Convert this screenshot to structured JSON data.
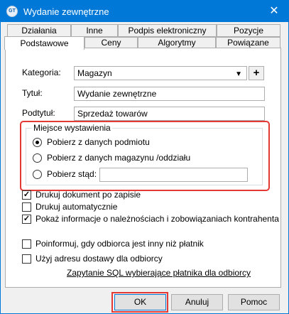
{
  "window": {
    "title": "Wydanie zewnętrzne",
    "icon_text": "GT",
    "close_glyph": "✕"
  },
  "tabs": {
    "row1": [
      "Działania",
      "Inne",
      "Podpis elektroniczny",
      "Pozycje"
    ],
    "row2": [
      "Podstawowe",
      "Ceny",
      "Algorytmy",
      "Powiązane"
    ],
    "active": "Podstawowe"
  },
  "form": {
    "kategoria": {
      "label": "Kategoria:",
      "value": "Magazyn",
      "add_glyph": "+"
    },
    "tytul": {
      "label": "Tytuł:",
      "value": "Wydanie zewnętrzne"
    },
    "podtytul": {
      "label": "Podtytuł:",
      "value": "Sprzedaż towarów"
    }
  },
  "miejsce": {
    "title": "Miejsce wystawienia",
    "options": [
      {
        "label": "Pobierz z danych podmiotu",
        "checked": true
      },
      {
        "label": "Pobierz z danych magazynu /oddziału",
        "checked": false
      },
      {
        "label": "Pobierz stąd:",
        "checked": false,
        "input_value": ""
      }
    ]
  },
  "checks": [
    {
      "label": "Drukuj dokument po zapisie",
      "checked": true
    },
    {
      "label": "Drukuj automatycznie",
      "checked": false
    },
    {
      "label": "Pokaż informacje o należnościach i zobowiązaniach kontrahenta",
      "checked": true
    },
    {
      "label": "Poinformuj, gdy odbiorca jest inny niż płatnik",
      "checked": false
    },
    {
      "label": "Użyj adresu dostawy dla odbiorcy",
      "checked": false
    }
  ],
  "sql_link": "Zapytanie SQL wybierające płatnika dla odbiorcy",
  "buttons": {
    "ok": "OK",
    "cancel": "Anuluj",
    "help": "Pomoc"
  },
  "colors": {
    "title_bar": "#0078d7",
    "highlight": "#e53935"
  }
}
